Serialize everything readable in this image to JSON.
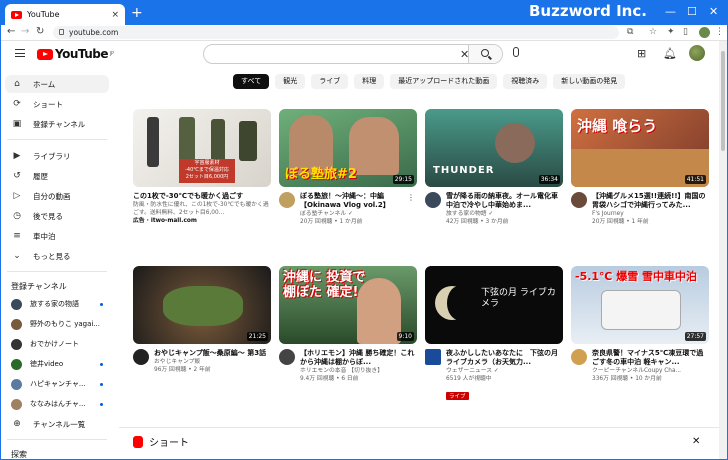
{
  "browser": {
    "tab_title": "YouTube",
    "tab_close": "×",
    "new_tab": "+",
    "brand": "Buzzword Inc.",
    "url": "youtube.com",
    "minimize": "—",
    "maximize": "☐",
    "close": "✕"
  },
  "header": {
    "logo_text": "YouTube",
    "logo_sup": "JP",
    "search_clear": "✕"
  },
  "sidebar": {
    "items": [
      {
        "label": "ホーム",
        "icon": "home-icon"
      },
      {
        "label": "ショート",
        "icon": "shorts-icon"
      },
      {
        "label": "登録チャンネル",
        "icon": "subscriptions-icon"
      },
      {
        "label": "ライブラリ",
        "icon": "library-icon"
      },
      {
        "label": "履歴",
        "icon": "history-icon"
      },
      {
        "label": "自分の動画",
        "icon": "your-videos-icon"
      },
      {
        "label": "後で見る",
        "icon": "watch-later-icon"
      },
      {
        "label": "車中泊",
        "icon": "playlist-icon"
      },
      {
        "label": "もっと見る",
        "icon": "chevron-down-icon"
      }
    ],
    "subs_heading": "登録チャンネル",
    "channels": [
      {
        "name": "旅する家の物語",
        "color": "#3a4a5a",
        "dot": true
      },
      {
        "name": "野外のもりこ yagai...",
        "color": "#7a5a3a",
        "dot": true
      },
      {
        "name": "おでかけノート",
        "color": "#333333",
        "dot": false
      },
      {
        "name": "徳井video",
        "color": "#2a6a2a",
        "dot": true
      },
      {
        "name": "ハピキャンチャ...",
        "color": "#5a7aa0",
        "dot": true
      },
      {
        "name": "ななみはんチャ...",
        "color": "#a08060",
        "dot": true
      }
    ],
    "channel_list": "チャンネル一覧",
    "explore": "探索"
  },
  "chips": [
    "すべて",
    "観光",
    "ライブ",
    "料理",
    "最近アップロードされた動画",
    "視聴済み",
    "新しい動画の発見"
  ],
  "videos": [
    {
      "title": "この1枚で-30℃でも暖かく過ごす",
      "line2": "防風・防水性に優れ、この1枚で-30℃でも暖かく過ごす。送料無料、2セット目6,00...",
      "line3": "広告 · itwo-mall.com",
      "duration": "",
      "overlay": "宇宙服素材\n-40℃まで保温対応\n2セット目6,000円",
      "bg": "#e8e6e2",
      "avatar": "#ffffff",
      "ad": true
    },
    {
      "title": "ぼる塾旅！〜沖縄〜：中編【Okinawa Vlog vol.2】",
      "line2": "ぼる塾チャンネル ✓",
      "line3": "20万 回視聴 • 1 か月前",
      "duration": "29:15",
      "overlay": "ぼる塾旅#2",
      "bg": "#5a9a6a",
      "avatar": "#c0a060"
    },
    {
      "title": "雪が降る雨の納車夜。オール電化車中泊で冷やし中華始めま...",
      "line2": "旅する家の物語 ✓",
      "line3": "42万 回視聴 • 3 か月前",
      "duration": "36:34",
      "overlay": "THUNDER",
      "bg": "#3a7a6a",
      "avatar": "#3a4a5a"
    },
    {
      "title": "【沖縄グルメ15選!!連続!!】南国の胃袋ハシゴで沖縄行ってみた...",
      "line2": "F's Journey",
      "line3": "20万 回視聴 • 1 年前",
      "duration": "41:51",
      "overlay": "沖縄 喰らう",
      "bg": "#b05a3a",
      "avatar": "#6a4a3a"
    },
    {
      "title": "おやじキャンプ飯〜桑原編〜 第3話",
      "line2": "おやじキャンプ飯",
      "line3": "96万 回視聴 • 2 年前",
      "duration": "21:25",
      "overlay": "",
      "bg": "#2a2a2a",
      "avatar": "#222222"
    },
    {
      "title": "【ホリエモン】沖縄 勝ち確定！これから沖縄は棚からぼ...",
      "line2": "ホリエモンの本音 【切り抜き】",
      "line3": "9.4万 回視聴 • 6 日前",
      "duration": "9:10",
      "overlay": "沖縄に 投資で 棚ぼた 確定!",
      "bg": "#3a6a3a",
      "avatar": "#444444"
    },
    {
      "title": "夜ふかししたいあなたに　下弦の月ライブカメラ（お天気力...",
      "line2": "ウェザーニュース ✓",
      "line3": "6519 人が視聴中",
      "duration": "",
      "overlay": "下弦の月 ライブカメラ",
      "bg": "#0a0a0a",
      "avatar": "#1a4a9a",
      "live": "ライブ"
    },
    {
      "title": "奈良県警！マイナス5℃凍豆環で過ごす冬の車中泊 軽キャン...",
      "line2": "クーピーチャンネルCoupy Cha...",
      "line3": "336万 回視聴 • 10 か月前",
      "duration": "27:57",
      "overlay": "-5.1℃ 爆雪 雪中車中泊",
      "bg": "#9ab4d0",
      "avatar": "#d0a050"
    }
  ],
  "shorts_label": "ショート",
  "shorts_close": "✕",
  "colors": {
    "accent_blue": "#1a73e8",
    "youtube_red": "#ff0000"
  }
}
